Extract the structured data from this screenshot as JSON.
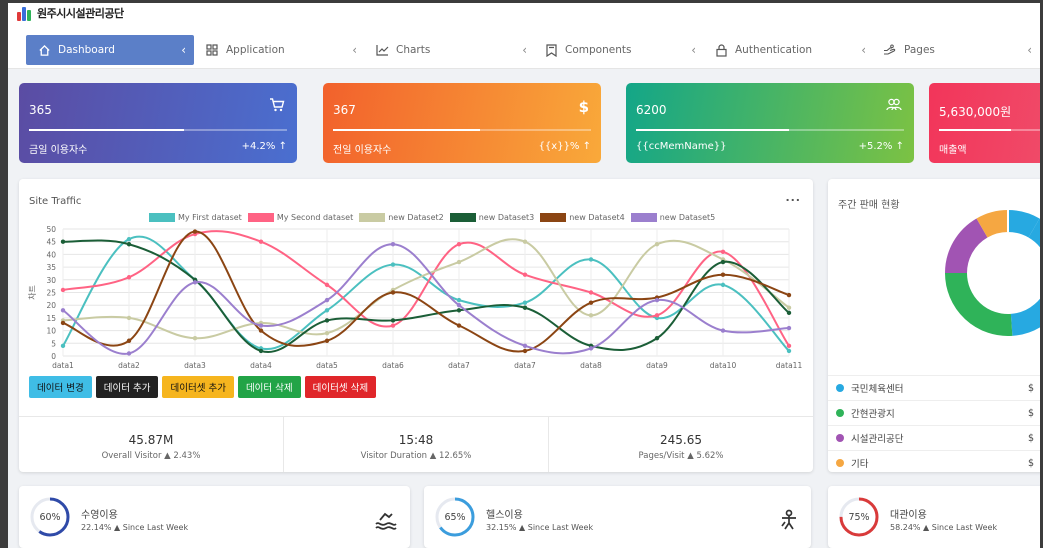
{
  "header": {
    "logo_text": "원주시시설관리공단"
  },
  "nav": {
    "items": [
      {
        "label": "Dashboard",
        "icon": "home-icon"
      },
      {
        "label": "Application",
        "icon": "grid-icon"
      },
      {
        "label": "Charts",
        "icon": "line-chart-icon"
      },
      {
        "label": "Components",
        "icon": "bookmark-icon"
      },
      {
        "label": "Authentication",
        "icon": "lock-icon"
      },
      {
        "label": "Pages",
        "icon": "hand-icon"
      }
    ],
    "chevron": "‹"
  },
  "stats": [
    {
      "value": "365",
      "label": "금일 이용자수",
      "change": "+4.2%",
      "icon": "cart-icon",
      "progress": 0.6
    },
    {
      "value": "367",
      "label": "전일 이용자수",
      "change": "{{x}}%",
      "icon": "dollar-icon",
      "progress": 0.57
    },
    {
      "value": "6200",
      "label": "{{ccMemName}}",
      "change": "+5.2%",
      "icon": "users-icon",
      "progress": 0.57
    },
    {
      "value": "5,630,000원",
      "label": "매출액",
      "change": "",
      "icon": "",
      "progress": 0.6
    }
  ],
  "traffic": {
    "title": "Site Traffic",
    "menu": "...",
    "buttons": [
      {
        "label": "데이터 변경",
        "color": "#3fbde6",
        "text": "#111"
      },
      {
        "label": "데이터 추가",
        "color": "#222222",
        "text": "#fff"
      },
      {
        "label": "데이터셋 추가",
        "color": "#f6b51e",
        "text": "#111"
      },
      {
        "label": "데이터 삭제",
        "color": "#22a447",
        "text": "#fff"
      },
      {
        "label": "데이터셋 삭제",
        "color": "#e0262a",
        "text": "#fff"
      }
    ],
    "metrics": [
      {
        "value": "45.87M",
        "sub": "Overall Visitor ▲ 2.43%"
      },
      {
        "value": "15:48",
        "sub": "Visitor Duration ▲ 12.65%"
      },
      {
        "value": "245.65",
        "sub": "Pages/Visit ▲ 5.62%"
      }
    ]
  },
  "chart_data": {
    "type": "line",
    "title": "",
    "xlabel": "",
    "ylabel": "차트",
    "ylim": [
      0,
      50
    ],
    "yticks": [
      0,
      5,
      10,
      15,
      20,
      25,
      30,
      35,
      40,
      45,
      50
    ],
    "grid": true,
    "legend_position": "top",
    "categories": [
      "data1",
      "data2",
      "data3",
      "data4",
      "data5",
      "data6",
      "data7",
      "data7",
      "data8",
      "data9",
      "data10",
      "data11"
    ],
    "series": [
      {
        "name": "My First dataset",
        "color": "#4bc0c0",
        "values": [
          4,
          46,
          30,
          3,
          18,
          36,
          22,
          21,
          38,
          15,
          28,
          2
        ]
      },
      {
        "name": "My Second dataset",
        "color": "#ff6384",
        "values": [
          26,
          31,
          48,
          45,
          28,
          12,
          44,
          32,
          25,
          16,
          41,
          4
        ]
      },
      {
        "name": "new Dataset2",
        "color": "#c9cba3",
        "values": [
          14,
          15,
          7,
          13,
          9,
          26,
          37,
          45,
          16,
          44,
          38,
          19
        ]
      },
      {
        "name": "new Dataset3",
        "color": "#1b5e37",
        "values": [
          45,
          44,
          30,
          2,
          14,
          14,
          18,
          19,
          4,
          7,
          37,
          17
        ]
      },
      {
        "name": "new Dataset4",
        "color": "#8b4513",
        "values": [
          13,
          6,
          49,
          10,
          6,
          25,
          12,
          2,
          21,
          23,
          32,
          24
        ]
      },
      {
        "name": "new Dataset5",
        "color": "#9b7fce",
        "values": [
          18,
          1,
          29,
          12,
          22,
          44,
          20,
          4,
          3,
          22,
          10,
          11
        ]
      }
    ]
  },
  "weekly": {
    "title": "주간 판매 현황",
    "items": [
      {
        "label": "국민체육센터",
        "color": "#27a9e1",
        "value": "$"
      },
      {
        "label": "간현관광지",
        "color": "#2fb359",
        "value": "$"
      },
      {
        "label": "시설관리공단",
        "color": "#a154b3",
        "value": "$"
      },
      {
        "label": "기타",
        "color": "#f5a742",
        "value": "$"
      }
    ]
  },
  "minis": [
    {
      "pct": "60%",
      "title": "수영이용",
      "sub": "22.14% ▲ Since Last Week",
      "ring_color": "#2f4aa8",
      "fraction": 0.6,
      "icon": "swim-icon"
    },
    {
      "pct": "65%",
      "title": "헬스이용",
      "sub": "32.15% ▲ Since Last Week",
      "ring_color": "#3b9ddd",
      "fraction": 0.65,
      "icon": "fitness-icon"
    },
    {
      "pct": "75%",
      "title": "대관이용",
      "sub": "58.24% ▲ Since Last Week",
      "ring_color": "#d93a3a",
      "fraction": 0.75,
      "icon": ""
    }
  ]
}
